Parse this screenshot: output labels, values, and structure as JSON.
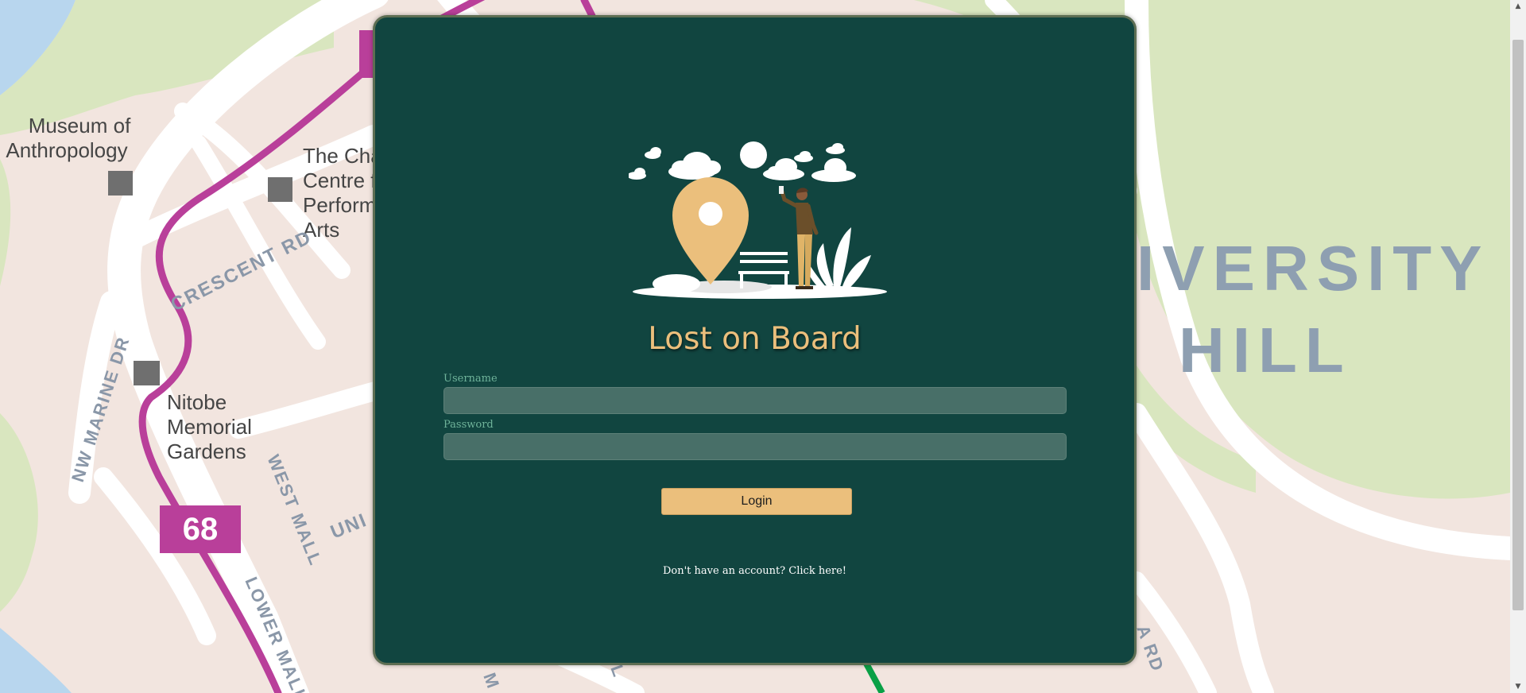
{
  "map": {
    "labels": {
      "museum": [
        "Museum of",
        "Anthropology"
      ],
      "chan": [
        "The Cha",
        "Centre f",
        "Perform",
        "Arts"
      ],
      "nitobe": [
        "Nitobe",
        "Memorial",
        "Gardens"
      ],
      "crescent_rd": "CRESCENT RD",
      "nw_marine_dr": "NW MARINE DR",
      "west_mall": "WEST MALL",
      "lower_mall": "LOWER MALL",
      "uni": "UNI",
      "university": "IVERSITY",
      "hill": "HILL",
      "rd": "A RD",
      "m": "M",
      "l": "L"
    },
    "route_badge": "68",
    "colors": {
      "land": "#f2e5df",
      "park": "#d9e6bf",
      "water": "#b8d6ee",
      "road": "#ffffff",
      "route": "#b93f9a",
      "route_green": "#0aa046"
    }
  },
  "login": {
    "illustration": "location-pin-person-bench-illustration",
    "title": "Lost on Board",
    "username_label": "Username",
    "username_value": "",
    "password_label": "Password",
    "password_value": "",
    "login_button": "Login",
    "signup_link": "Don't have an account? Click here!",
    "colors": {
      "card_bg": "#114540",
      "accent": "#ebbf7c",
      "input_bg": "#486f68",
      "label": "#6fb39a"
    }
  },
  "scrollbar": {
    "up_icon": "triangle-up-icon",
    "down_icon": "triangle-down-icon"
  }
}
